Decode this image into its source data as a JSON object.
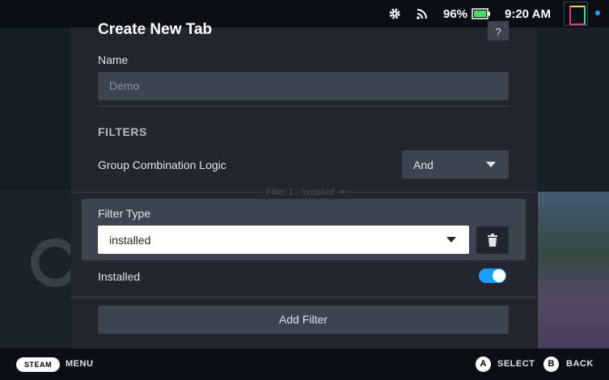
{
  "status_bar": {
    "battery": "96%",
    "time": "9:20 AM",
    "icons": [
      "gear-icon",
      "wifi-icon",
      "battery-icon"
    ]
  },
  "dialog": {
    "title": "Create New Tab",
    "help": "?",
    "name_label": "Name",
    "name_value": "Demo",
    "filters_heading": "FILTERS",
    "group_logic_label": "Group Combination Logic",
    "group_logic_value": "And",
    "filter_divider": "Filter 1 - Installed",
    "filter_type_label": "Filter Type",
    "filter_type_value": "installed",
    "installed_label": "Installed",
    "installed_toggle": true,
    "add_filter_label": "Add Filter"
  },
  "bottom_bar": {
    "steam": "STEAM",
    "menu": "MENU",
    "select_button": "A",
    "select": "SELECT",
    "back_button": "B",
    "back": "BACK"
  },
  "colors": {
    "accent": "#1a9fff",
    "panel": "#23262e",
    "control": "#3d4450"
  }
}
